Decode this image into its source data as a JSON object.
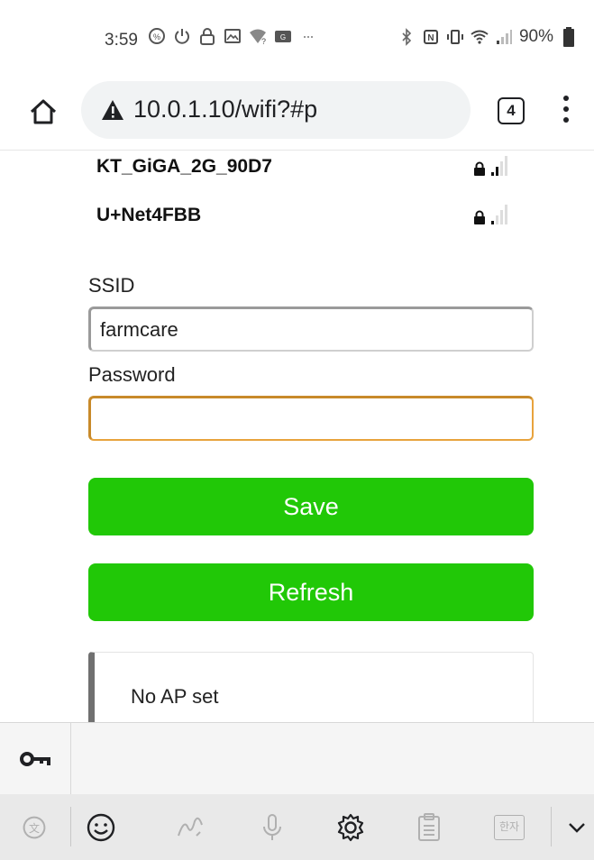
{
  "status_bar": {
    "time": "3:59",
    "battery": "90%"
  },
  "browser": {
    "url": "10.0.1.10/wifi?#p",
    "tab_count": "4"
  },
  "networks": [
    {
      "ssid": "KT_GiGA_2G_90D7",
      "locked": true,
      "signal_bars": 2
    },
    {
      "ssid": "U+Net4FBB",
      "locked": true,
      "signal_bars": 1
    }
  ],
  "form": {
    "ssid_label": "SSID",
    "ssid_value": "farmcare",
    "password_label": "Password",
    "password_value": "",
    "save_label": "Save",
    "refresh_label": "Refresh"
  },
  "status_message": "No AP set",
  "keyboard": {
    "hanja_label": "한자"
  },
  "colors": {
    "button_green": "#21c807",
    "focus_orange": "#e8a33d"
  }
}
